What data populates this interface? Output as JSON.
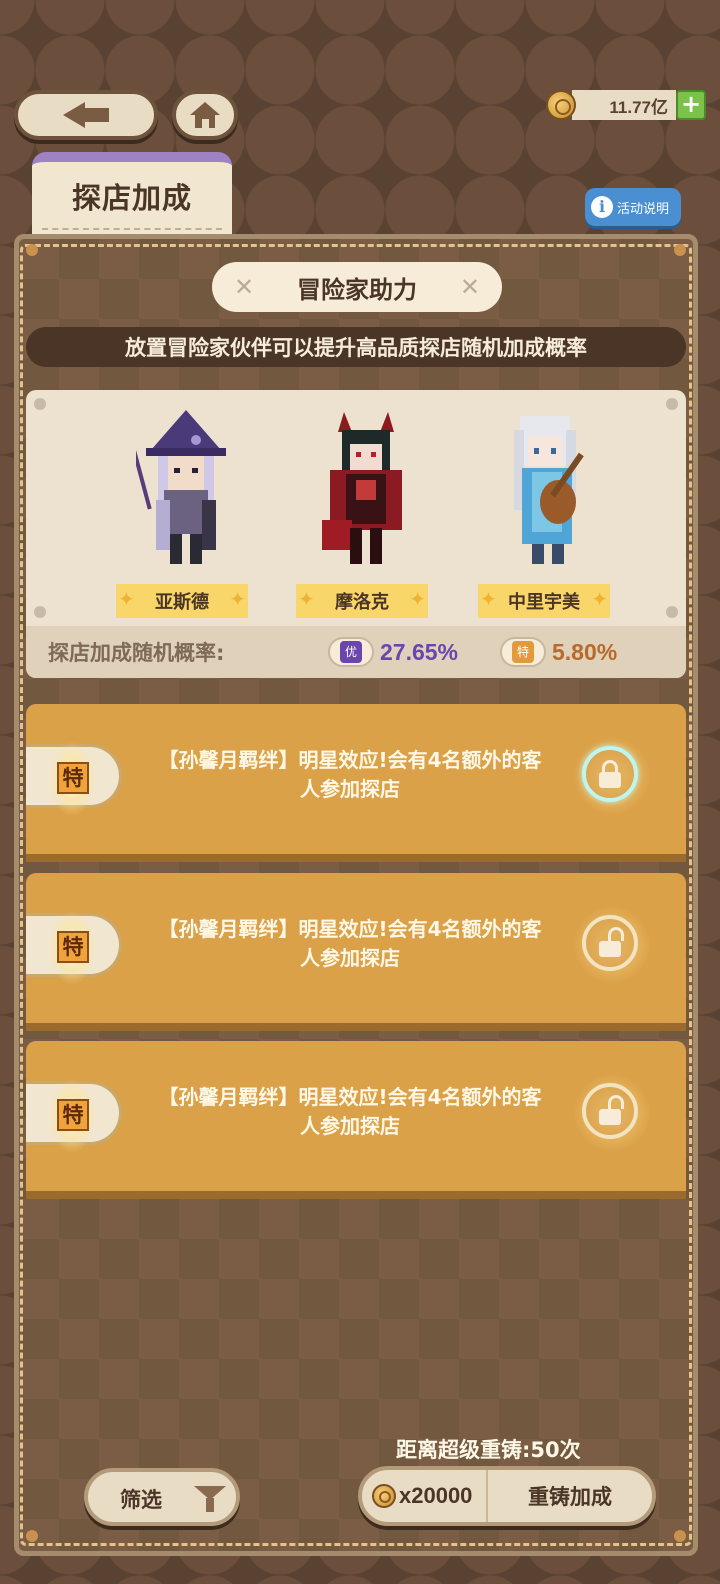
{
  "currency": {
    "amount": "11.77亿",
    "add_label": "+"
  },
  "tab": {
    "label": "探店加成"
  },
  "info": {
    "icon_text": "i",
    "label": "活动说明"
  },
  "panel": {
    "title": "冒险家助力",
    "title_decoration": "✕",
    "subtitle": "放置冒险家伙伴可以提升高品质探店随机加成概率"
  },
  "heroes": [
    {
      "name": "亚斯德"
    },
    {
      "name": "摩洛克"
    },
    {
      "name": "中里宇美"
    }
  ],
  "probability": {
    "label": "探店加成随机概率:",
    "tiers": [
      {
        "icon": "优",
        "value": "27.65%",
        "color": "#6a45b0"
      },
      {
        "icon": "特",
        "value": "5.80%",
        "color": "#b76a2a"
      }
    ]
  },
  "bonuses": [
    {
      "tier": "特",
      "text": "【孙馨月羁绊】明星效应!会有4名额外的客人参加探店",
      "locked": true
    },
    {
      "tier": "特",
      "text": "【孙馨月羁绊】明星效应!会有4名额外的客人参加探店",
      "locked": false
    },
    {
      "tier": "特",
      "text": "【孙馨月羁绊】明星效应!会有4名额外的客人参加探店",
      "locked": false
    }
  ],
  "footer": {
    "reforge_note": "距离超级重铸:50次",
    "filter_label": "筛选",
    "reforge_cost": "x20000",
    "reforge_label": "重铸加成"
  },
  "colors": {
    "accent_purple": "#9e82c4",
    "card_gold": "#dba149",
    "info_blue": "#4a8fd2",
    "plus_green": "#7bc24a"
  },
  "icons": [
    "back-arrow-icon",
    "home-icon",
    "coin-icon",
    "plus-icon",
    "info-icon",
    "lock-icon",
    "unlock-icon",
    "filter-funnel-icon"
  ]
}
